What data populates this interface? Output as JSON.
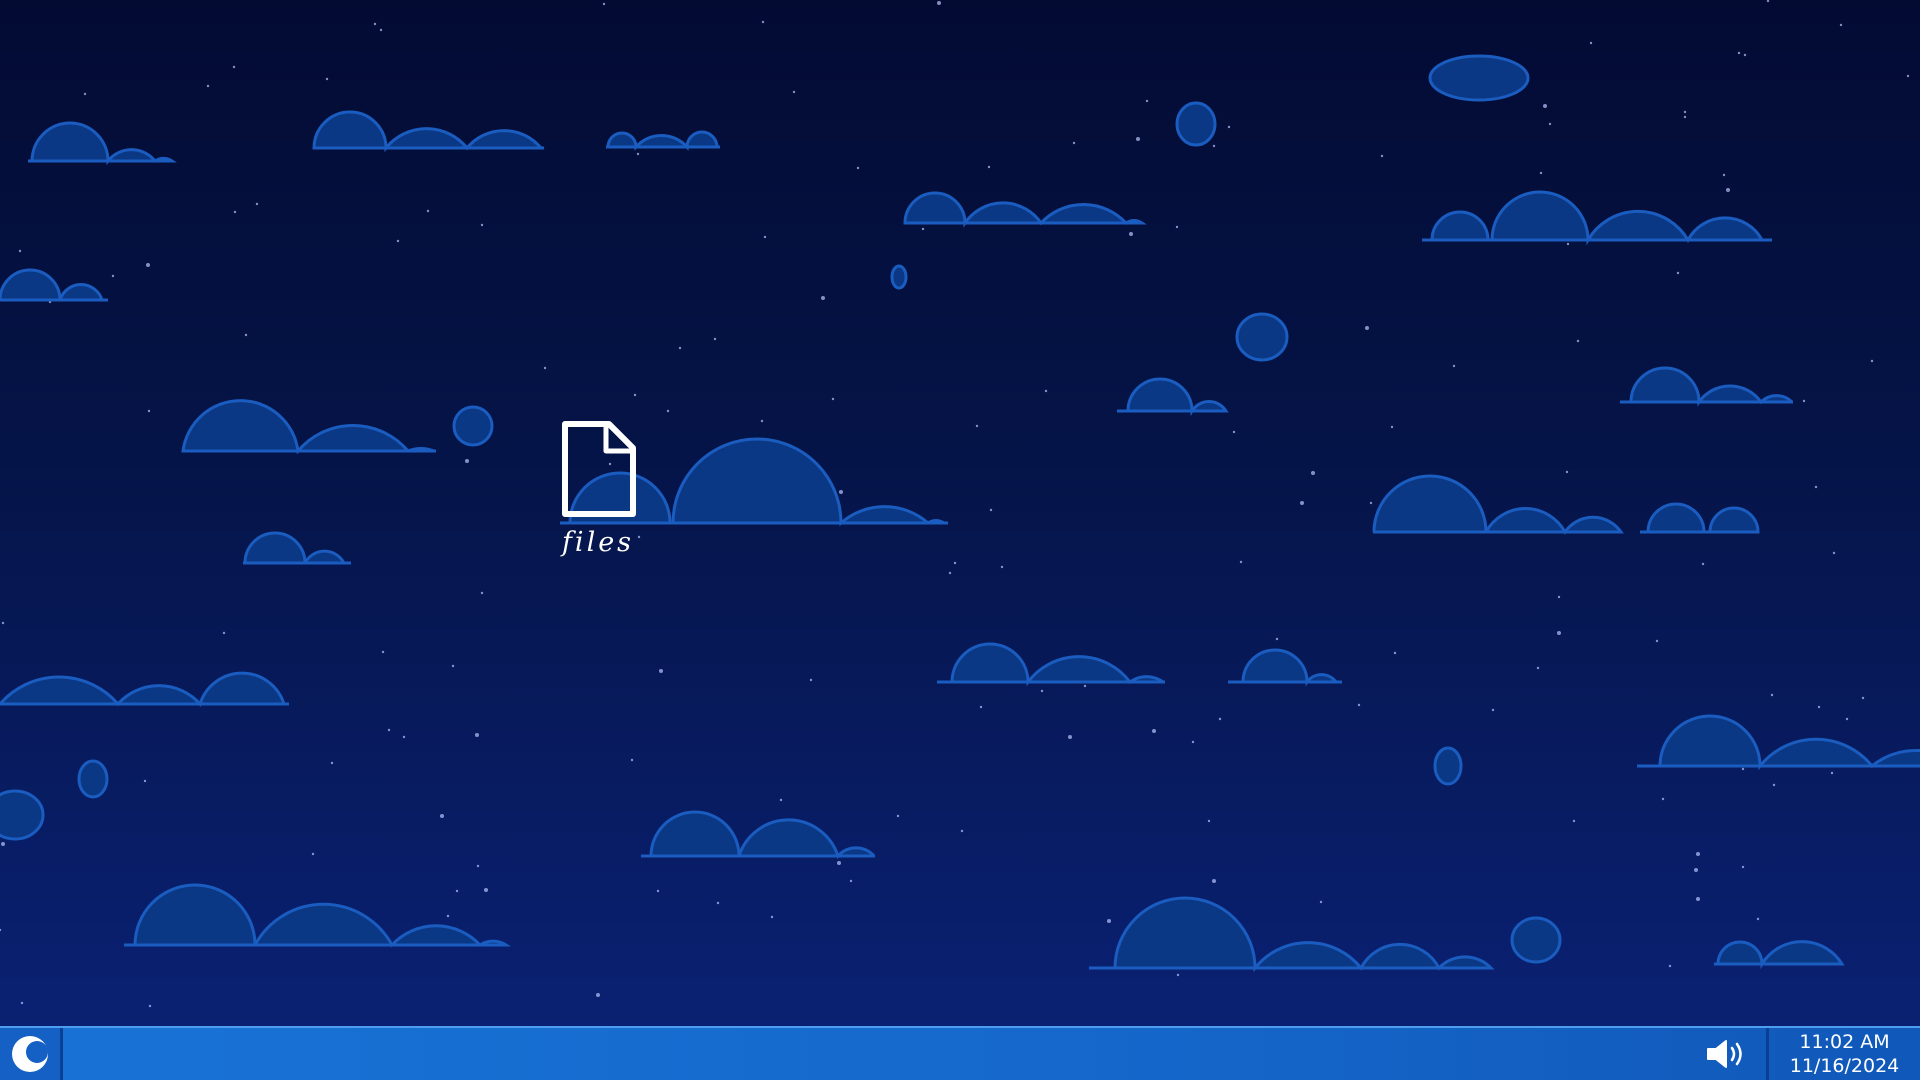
{
  "desktop": {
    "background_colors": {
      "top": "#030b33",
      "bottom": "#0a2173",
      "cloud_fill": "#0b3884",
      "cloud_stroke": "#1a5cbf"
    },
    "icons": [
      {
        "label": "files",
        "icon": "file-icon"
      }
    ]
  },
  "taskbar": {
    "color": "#1668cc",
    "start_button_icon": "crescent-moon-icon",
    "volume_icon": "speaker-icon",
    "clock": {
      "time": "11:02 AM",
      "date": "11/16/2024"
    }
  }
}
